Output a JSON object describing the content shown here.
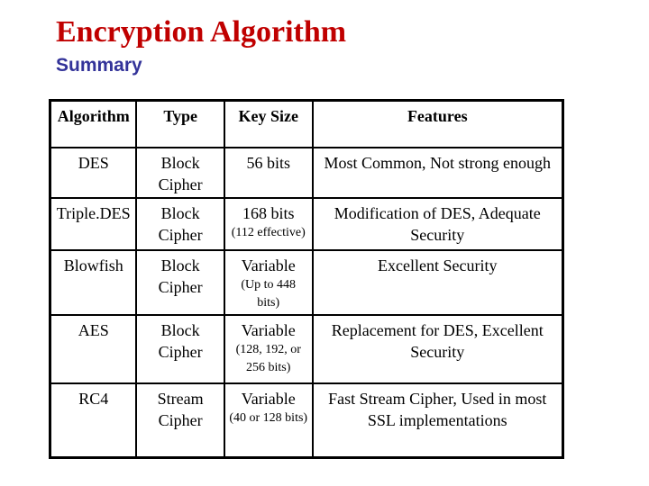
{
  "slide": {
    "title": "Encryption Algorithm",
    "subtitle": "Summary",
    "colors": {
      "title": "#c00000",
      "subtitle": "#333399"
    }
  },
  "table": {
    "headers": [
      "Algorithm",
      "Type",
      "Key Size",
      "Features"
    ],
    "rows": [
      {
        "algorithm": "DES",
        "type": "Block Cipher",
        "key_size": "56 bits",
        "key_note": "",
        "features": "Most Common, Not strong enough"
      },
      {
        "algorithm": "Triple.DES",
        "type": "Block Cipher",
        "key_size": "168 bits",
        "key_note": "(112 effective)",
        "features": "Modification of DES, Adequate Security"
      },
      {
        "algorithm": "Blowfish",
        "type": "Block Cipher",
        "key_size": "Variable",
        "key_note": "(Up to 448 bits)",
        "features": "Excellent Security"
      },
      {
        "algorithm": "AES",
        "type": "Block Cipher",
        "key_size": "Variable",
        "key_note": "(128, 192, or 256 bits)",
        "features": "Replacement for DES, Excellent Security"
      },
      {
        "algorithm": "RC4",
        "type": "Stream Cipher",
        "key_size": "Variable",
        "key_note": "(40 or 128 bits)",
        "features": "Fast Stream Cipher, Used in most SSL implementations"
      }
    ]
  }
}
